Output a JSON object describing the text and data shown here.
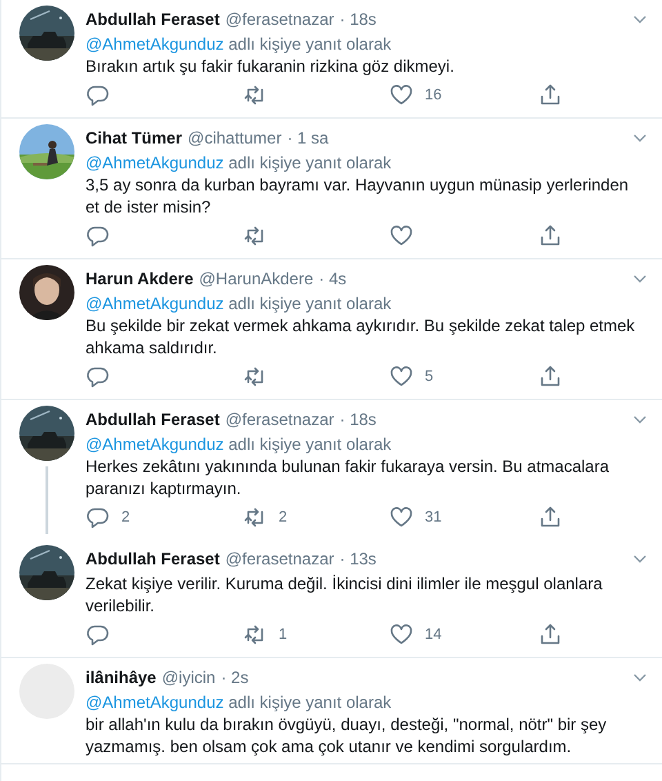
{
  "tweets": [
    {
      "name": "Abdullah Feraset",
      "handle": "@ferasetnazar",
      "time": "· 18s",
      "reply_to": {
        "mention": "@AhmetAkgunduz",
        "text": "adlı kişiye yanıt olarak"
      },
      "text": "Bırakın artık şu fakir fukaranin rizkina göz dikmeyi.",
      "thread_continues": false,
      "actions": [
        {
          "kind": "reply"
        },
        {
          "kind": "retweet"
        },
        {
          "kind": "like",
          "count": "16"
        },
        {
          "kind": "share"
        }
      ]
    },
    {
      "name": "Cihat Tümer",
      "handle": "@cihattumer",
      "time": "· 1 sa",
      "reply_to": {
        "mention": "@AhmetAkgunduz",
        "text": "adlı kişiye yanıt olarak"
      },
      "text": "3,5 ay sonra da kurban bayramı var. Hayvanın uygun münasip yerlerinden et de ister misin?",
      "thread_continues": false,
      "actions": [
        {
          "kind": "reply"
        },
        {
          "kind": "retweet"
        },
        {
          "kind": "like"
        },
        {
          "kind": "share"
        }
      ]
    },
    {
      "name": "Harun Akdere",
      "handle": "@HarunAkdere",
      "time": "· 4s",
      "reply_to": {
        "mention": "@AhmetAkgunduz",
        "text": "adlı kişiye yanıt olarak"
      },
      "text": "Bu şekilde bir zekat vermek ahkama aykırıdır. Bu şekilde zekat talep etmek ahkama saldırıdır.",
      "thread_continues": false,
      "actions": [
        {
          "kind": "reply"
        },
        {
          "kind": "retweet"
        },
        {
          "kind": "like",
          "count": "5"
        },
        {
          "kind": "share"
        }
      ]
    },
    {
      "name": "Abdullah Feraset",
      "handle": "@ferasetnazar",
      "time": "· 18s",
      "reply_to": {
        "mention": "@AhmetAkgunduz",
        "text": "adlı kişiye yanıt olarak"
      },
      "text": "Herkes zekâtını yakınında bulunan fakir fukaraya versin. Bu atmacalara paranızı kaptırmayın.",
      "thread_continues": true,
      "actions": [
        {
          "kind": "reply",
          "count": "2"
        },
        {
          "kind": "retweet",
          "count": "2"
        },
        {
          "kind": "like",
          "count": "31"
        },
        {
          "kind": "share"
        }
      ]
    },
    {
      "name": "Abdullah Feraset",
      "handle": "@ferasetnazar",
      "time": "· 13s",
      "text": "Zekat kişiye verilir. Kuruma değil. İkincisi dini ilimler ile meşgul olanlara verilebilir.",
      "thread_continues": false,
      "actions": [
        {
          "kind": "reply"
        },
        {
          "kind": "retweet",
          "count": "1"
        },
        {
          "kind": "like",
          "count": "14"
        },
        {
          "kind": "share"
        }
      ]
    },
    {
      "name": "ilânihâye",
      "handle": "@iyicin",
      "time": "· 2s",
      "reply_to": {
        "mention": "@AhmetAkgunduz",
        "text": "adlı kişiye yanıt olarak"
      },
      "text": "bir allah'ın kulu da bırakın övgüyü, duayı, desteği, \"normal, nötr\" bir şey yazmamış. ben olsam çok ama çok utanır ve kendimi sorgulardım.",
      "thread_continues": false
    }
  ]
}
